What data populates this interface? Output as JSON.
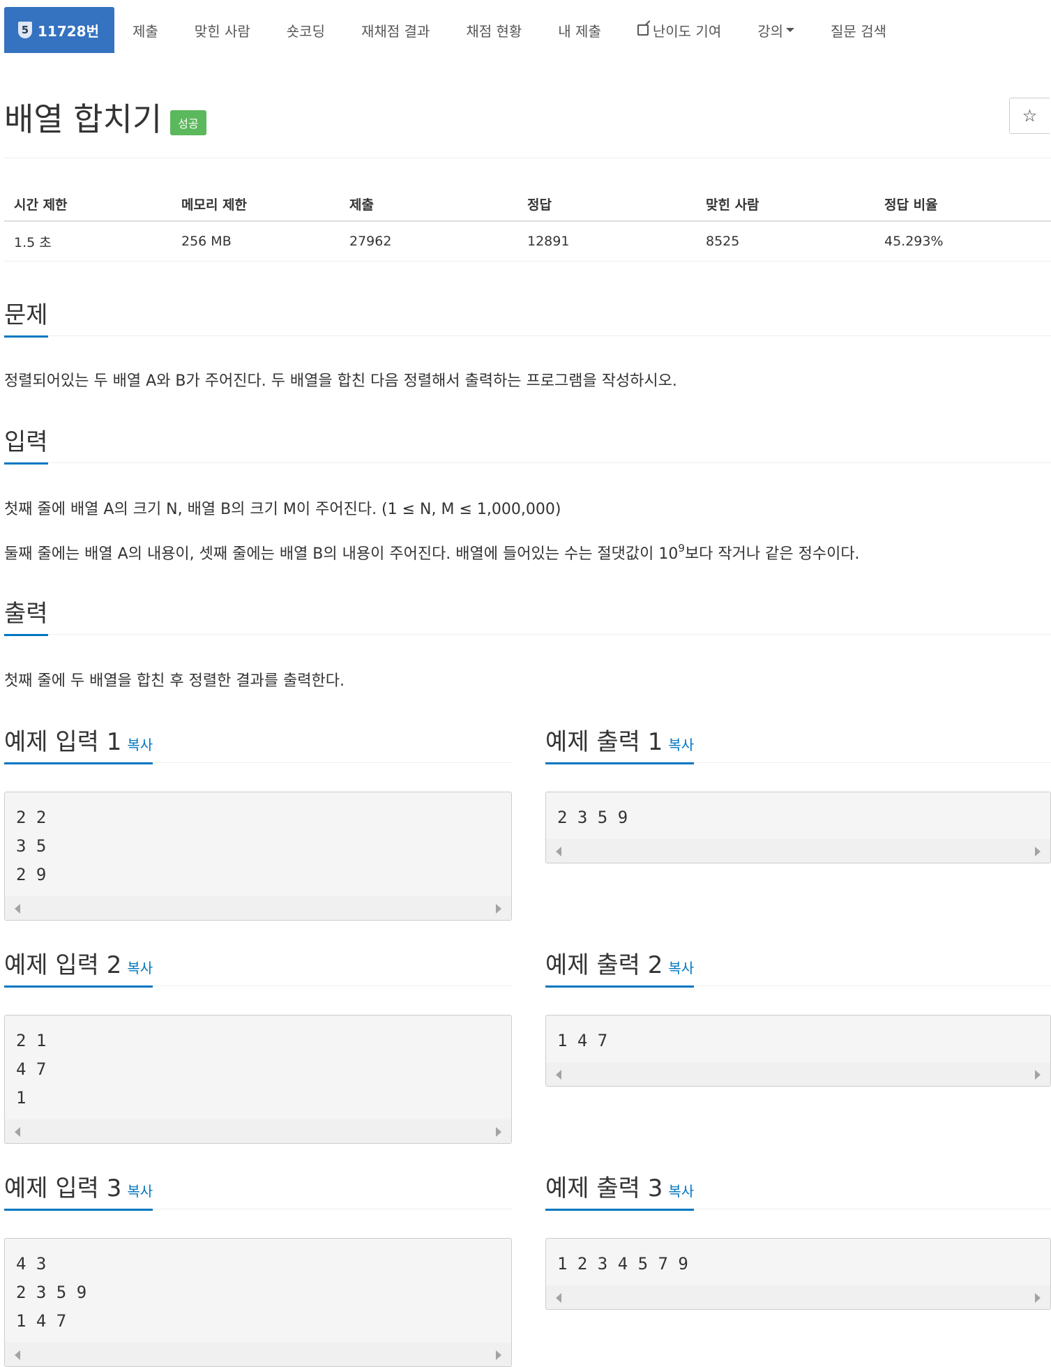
{
  "nav": {
    "problem_number": "11728번",
    "level_badge": "5",
    "items": [
      "제출",
      "맞힌 사람",
      "숏코딩",
      "재채점 결과",
      "채점 현황",
      "내 제출",
      "난이도 기여",
      "강의",
      "질문 검색"
    ]
  },
  "title": "배열 합치기",
  "status_badge": "성공",
  "star_icon": "☆",
  "info": {
    "headers": [
      "시간 제한",
      "메모리 제한",
      "제출",
      "정답",
      "맞힌 사람",
      "정답 비율"
    ],
    "values": [
      "1.5 초",
      "256 MB",
      "27962",
      "12891",
      "8525",
      "45.293%"
    ]
  },
  "sections": {
    "problem": {
      "heading": "문제",
      "text": "정렬되어있는 두 배열 A와 B가 주어진다. 두 배열을 합친 다음 정렬해서 출력하는 프로그램을 작성하시오."
    },
    "input": {
      "heading": "입력",
      "line1": "첫째 줄에 배열 A의 크기 N, 배열 B의 크기 M이 주어진다. (1 ≤ N, M ≤ 1,000,000)",
      "line2_pre": "둘째 줄에는 배열 A의 내용이, 셋째 줄에는 배열 B의 내용이 주어진다. 배열에 들어있는 수는 절댓값이 10",
      "line2_sup": "9",
      "line2_post": "보다 작거나 같은 정수이다."
    },
    "output": {
      "heading": "출력",
      "text": "첫째 줄에 두 배열을 합친 후 정렬한 결과를 출력한다."
    }
  },
  "copy_label": "복사",
  "samples": [
    {
      "input_title": "예제 입력 1",
      "input": "2 2\n3 5\n2 9",
      "output_title": "예제 출력 1",
      "output": "2 3 5 9"
    },
    {
      "input_title": "예제 입력 2",
      "input": "2 1\n4 7\n1",
      "output_title": "예제 출력 2",
      "output": "1 4 7"
    },
    {
      "input_title": "예제 입력 3",
      "input": "4 3\n2 3 5 9\n1 4 7",
      "output_title": "예제 출력 3",
      "output": "1 2 3 4 5 7 9"
    }
  ]
}
